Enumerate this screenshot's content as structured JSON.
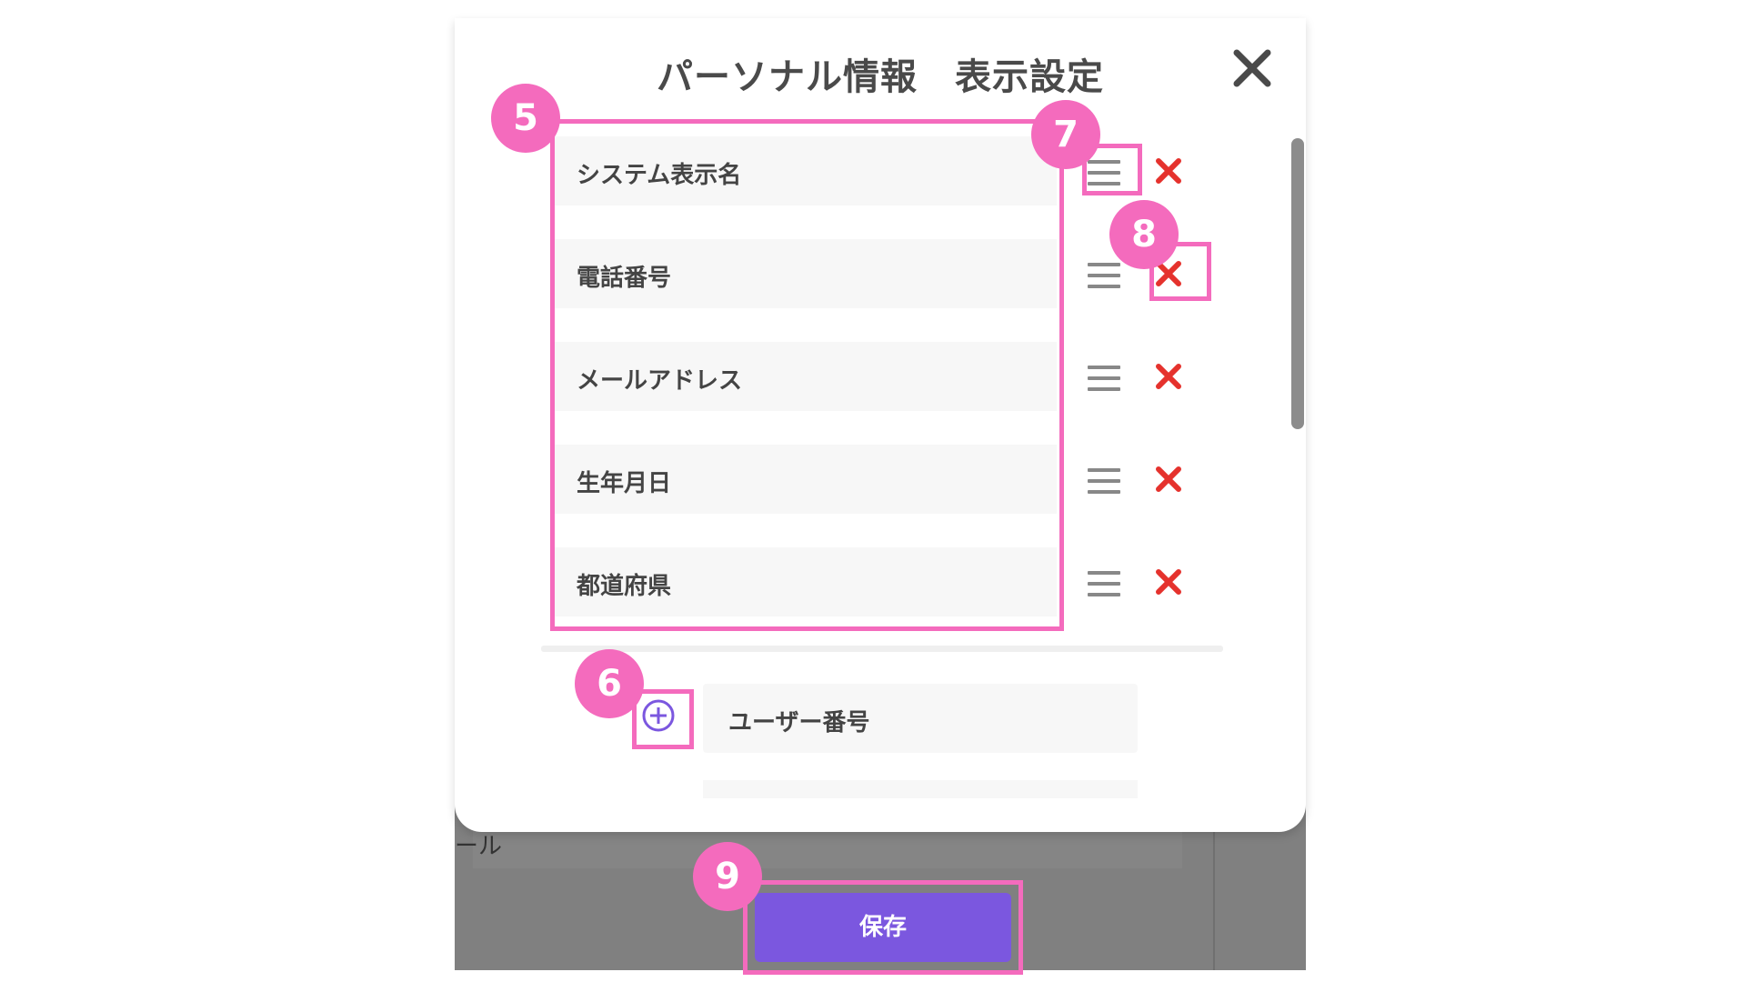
{
  "modal": {
    "title": "パーソナル情報　表示設定",
    "selected_items": [
      {
        "label": "システム表示名"
      },
      {
        "label": "電話番号"
      },
      {
        "label": "メールアドレス"
      },
      {
        "label": "生年月日"
      },
      {
        "label": "都道府県"
      }
    ],
    "available_items": [
      {
        "label": "ユーザー番号"
      }
    ]
  },
  "background": {
    "partial_text": "ール"
  },
  "footer": {
    "save_label": "保存"
  },
  "annotations": [
    "5",
    "6",
    "7",
    "8",
    "9"
  ],
  "colors": {
    "accent": "#7b57df",
    "delete": "#e5322d",
    "highlight": "#f46bbd"
  }
}
